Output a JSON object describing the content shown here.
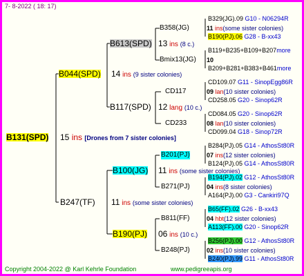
{
  "header": {
    "date": "7-  8-2022 ( 18:  17)"
  },
  "footer": {
    "copyright": "Copyright 2004-2022 @ Karl Kehrle Foundation",
    "site": "www.pedigreeapis.org"
  },
  "root": {
    "name": "B131(SPD)",
    "ins": "15",
    "ins_label": "ins",
    "note": "[Drones from 7 sister colonies]"
  },
  "gen1": {
    "top": {
      "name": "B044(SPD)",
      "ins": "14",
      "ins_label": "ins",
      "note": "(9 sister colonies)"
    },
    "bottom": {
      "name": "B247(TF)",
      "ins": "11",
      "ins_label": "ins",
      "note": "(some sister colonies)"
    }
  },
  "gen2": {
    "a": {
      "name": "B613(SPD)",
      "ins": "13",
      "ins_label": "ins",
      "note": "(8 c.)"
    },
    "b": {
      "name": "B117(SPD)",
      "ins": "12",
      "ins_label": "lang",
      "note": "(10 c.)"
    },
    "c": {
      "name": "B100(JG)",
      "ins": "11",
      "ins_label": "ins",
      "note": "(some sister colonies)"
    },
    "d": {
      "name": "B190(PJ)",
      "ins": "06",
      "ins_label": "ins",
      "note": "(10 c.)"
    }
  },
  "gen3": [
    {
      "name": "B358(JG)",
      "ins": "11",
      "ins_label": "ins",
      "note": "(some sister colonies)"
    },
    {
      "name": "Bmix13(JG)",
      "ins": "10",
      "ins_label": "",
      "note": ""
    },
    {
      "name": "CD117",
      "ins": "09",
      "ins_label": "lan",
      "note": "(10 sister colonies)"
    },
    {
      "name": "CD233",
      "ins": "08",
      "ins_label": "lan",
      "note": "(10 sister colonies)"
    },
    {
      "name": "B201(PJ)",
      "ins": "07",
      "ins_label": "ins",
      "note": "(12 sister colonies)"
    },
    {
      "name": "B271(PJ)",
      "ins": "04",
      "ins_label": "ins",
      "note": "(8 sister colonies)"
    },
    {
      "name": "B811(FF)",
      "ins": "04",
      "ins_label": "hbt",
      "note": "(12 sister colonies)"
    },
    {
      "name": "B248(PJ)",
      "ins": "02",
      "ins_label": "ins",
      "note": "(10 sister colonies)"
    }
  ],
  "gen4": [
    {
      "name": "B329(JG).09",
      "info": "G10 - N06294R"
    },
    {
      "name": "B190(PJ).06",
      "info": "G28 - B-xx43"
    },
    {
      "name": "B119+B235+B109+B207",
      "info": "more"
    },
    {
      "name": "B209+B281+B383+B461",
      "info": "more"
    },
    {
      "name": "CD109.07",
      "info": "G11 - SinopEgg86R"
    },
    {
      "name": "CD258.05",
      "info": "G20 - Sinop62R"
    },
    {
      "name": "CD084.05",
      "info": "G20 - Sinop62R"
    },
    {
      "name": "CD099.04",
      "info": "G18 - Sinop72R"
    },
    {
      "name": "B284(PJ).05",
      "info": "G14 - AthosSt80R"
    },
    {
      "name": "B124(PJ).05",
      "info": "G14 - AthosSt80R"
    },
    {
      "name": "B194(PJ).02",
      "info": "G12 - AthosSt80R"
    },
    {
      "name": "A164(PJ).00",
      "info": "G3 - Cankiri97Q"
    },
    {
      "name": "B65(FF).02",
      "info": "G26 - B-xx43"
    },
    {
      "name": "A113(FF).00",
      "info": "G20 - Sinop62R"
    },
    {
      "name": "B256(PJ).00",
      "info": "G12 - AthosSt80R"
    },
    {
      "name": "B240(PJ).99",
      "info": "G11 - AthosSt80R"
    }
  ]
}
